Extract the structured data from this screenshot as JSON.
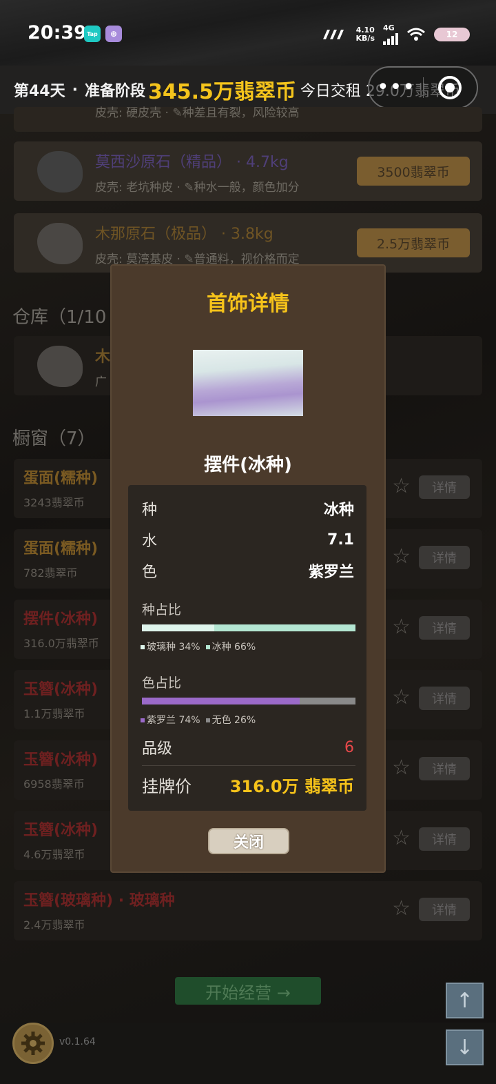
{
  "status_bar": {
    "time": "20:39",
    "apps": [
      "Tap",
      "⊕"
    ],
    "speed_value": "4.10",
    "speed_unit": "KB/s",
    "network": "4G",
    "battery": "12"
  },
  "header": {
    "day": "第44天",
    "separator": "·",
    "stage": "准备阶段",
    "money": "345.5万翡翠币",
    "rent": "今日交租 29.0万翡翠币",
    "capsule_more": "•••"
  },
  "stones": [
    {
      "name": "莫西沙原石（精品）",
      "weight": "· 4.7kg",
      "desc": "皮壳: 老坑种皮 · ✎种水一般，颜色加分",
      "price": "3500翡翠币",
      "color": "#4f3f78"
    },
    {
      "name": "木那原石（极品）",
      "weight": "· 3.8kg",
      "desc": "皮壳: 莫湾基皮 · ✎普通料，视价格而定",
      "price": "2.5万翡翠币",
      "color": "#6f5424"
    }
  ],
  "stone_partial_desc": "皮壳: 硬皮壳 · ✎种差且有裂，风险较高",
  "warehouse": {
    "title": "仓库（1/10",
    "item_initial": "木",
    "item_desc": "广"
  },
  "window": {
    "title": "橱窗（7）",
    "items": [
      {
        "name": "蛋面(糯种)",
        "price": "3243翡翠币",
        "color": "#7a5a22"
      },
      {
        "name": "蛋面(糯种)",
        "price": "782翡翠币",
        "color": "#7a5a22"
      },
      {
        "name": "摆件(冰种)",
        "price": "316.0万翡翠币",
        "color": "#6e2020"
      },
      {
        "name": "玉簪(冰种)",
        "price": "1.1万翡翠币",
        "color": "#6e2020"
      },
      {
        "name": "玉簪(冰种)",
        "price": "6958翡翠币",
        "color": "#6e2020"
      },
      {
        "name": "玉簪(冰种)",
        "price": "4.6万翡翠币",
        "color": "#6e2020"
      },
      {
        "name": "玉簪(玻璃种) · 玻璃种",
        "price": "2.4万翡翠币",
        "color": "#6e2020"
      }
    ],
    "detail_label": "详情",
    "star": "☆"
  },
  "start_button": "开始经营 →",
  "version": "v0.1.64",
  "scroll_up": "↑",
  "scroll_down": "↓",
  "modal": {
    "title": "首饰详情",
    "item_name": "摆件(冰种)",
    "attrs": [
      {
        "label": "种",
        "value": "冰种"
      },
      {
        "label": "水",
        "value": "7.1"
      },
      {
        "label": "色",
        "value": "紫罗兰"
      }
    ],
    "type_ratio": {
      "title": "种占比",
      "segments": [
        {
          "name": "玻璃种",
          "percent": 34,
          "label": "34%",
          "color": "#dff5ec"
        },
        {
          "name": "冰种",
          "percent": 66,
          "label": "66%",
          "color": "#b4e6d2"
        }
      ]
    },
    "color_ratio": {
      "title": "色占比",
      "segments": [
        {
          "name": "紫罗兰",
          "percent": 74,
          "label": "74%",
          "color": "#9b6ac9"
        },
        {
          "name": "无色",
          "percent": 26,
          "label": "26%",
          "color": "#8a8a8a"
        }
      ]
    },
    "grade_label": "品级",
    "grade_value": "6",
    "list_price_label": "挂牌价",
    "list_price_value": "316.0万 翡翠币",
    "close_label": "关闭"
  }
}
